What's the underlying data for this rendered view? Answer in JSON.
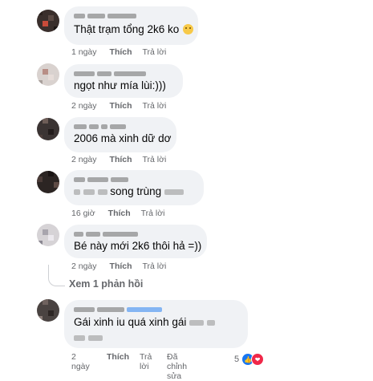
{
  "colors": {
    "bubble": "#f0f2f5",
    "meta": "#65676b",
    "like": "#1877f2",
    "love": "#f02849"
  },
  "actions": {
    "like": "Thích",
    "reply": "Trả lời",
    "edited": "Đã chỉnh sửa"
  },
  "comments": [
    {
      "text": "Thật trạm tổng 2k6 ko",
      "emoji": "unamused-face-icon",
      "time": "1 ngày"
    },
    {
      "text": "ngọt như mía lùi:)))",
      "time": "2 ngày"
    },
    {
      "text": "2006 mà xinh dữ dơ",
      "time": "2 ngày"
    },
    {
      "text": "song trùng",
      "time": "16 giờ"
    },
    {
      "text": "Bé này mới 2k6 thôi hả =))",
      "time": "2 ngày"
    },
    {
      "text": "Gái xinh iu quá xinh gái",
      "time": "2 ngày",
      "edited": true,
      "reaction_count": "5"
    }
  ],
  "view_replies": "Xem 1 phản hồi"
}
